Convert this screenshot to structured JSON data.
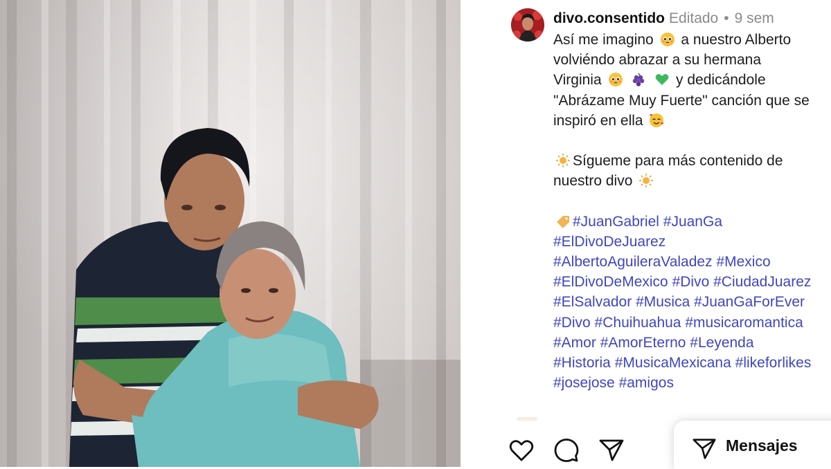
{
  "post": {
    "username": "divo.consentido",
    "edited": "Editado",
    "separator": "•",
    "time": "9 sem"
  },
  "caption": {
    "line1a": "Así me imagino",
    "line1b": "a nuestro Alberto",
    "line2": "volviéndo  abrazar a su hermana",
    "line3a": "Virginia",
    "line3b": "y dedicándole",
    "line4": "\"Abrázame Muy Fuerte\" canción que se",
    "line5": "inspiró en ella",
    "line6": "Sígueme para más contenido de",
    "line7": "nuestro divo"
  },
  "hashtags": {
    "l1a": "#JuanGabriel",
    "l1b": "#JuanGa",
    "l2": "#ElDivoDeJuarez",
    "l3a": "#AlbertoAguileraValadez",
    "l3b": "#Mexico",
    "l4a": "#ElDivoDeMexico",
    "l4b": "#Divo",
    "l4c": "#CiudadJuarez",
    "l5a": "#ElSalvador",
    "l5b": "#Musica",
    "l5c": "#JuanGaForEver",
    "l6a": "#Divo",
    "l6b": "#Chuihuahua",
    "l6c": "#musicaromantica",
    "l7a": "#Amor",
    "l7b": "#AmorEterno",
    "l7c": "#Leyenda",
    "l8a": "#Historia",
    "l8b": "#MusicaMexicana",
    "l8c": "#likeforlikes",
    "l9a": "#josejose",
    "l9b": "#amigos"
  },
  "actions": {
    "like_icon": "heart-icon",
    "comment_icon": "comment-icon",
    "share_icon": "send-icon",
    "messages_label": "Mensajes"
  },
  "emojis": [
    "pleading-face",
    "grapes",
    "green-heart",
    "smiling-face-with-hearts",
    "sun",
    "label-tag"
  ],
  "colors": {
    "hashtag": "#3f45c2",
    "text": "#1c1c1c",
    "muted": "#8a8a8a"
  }
}
